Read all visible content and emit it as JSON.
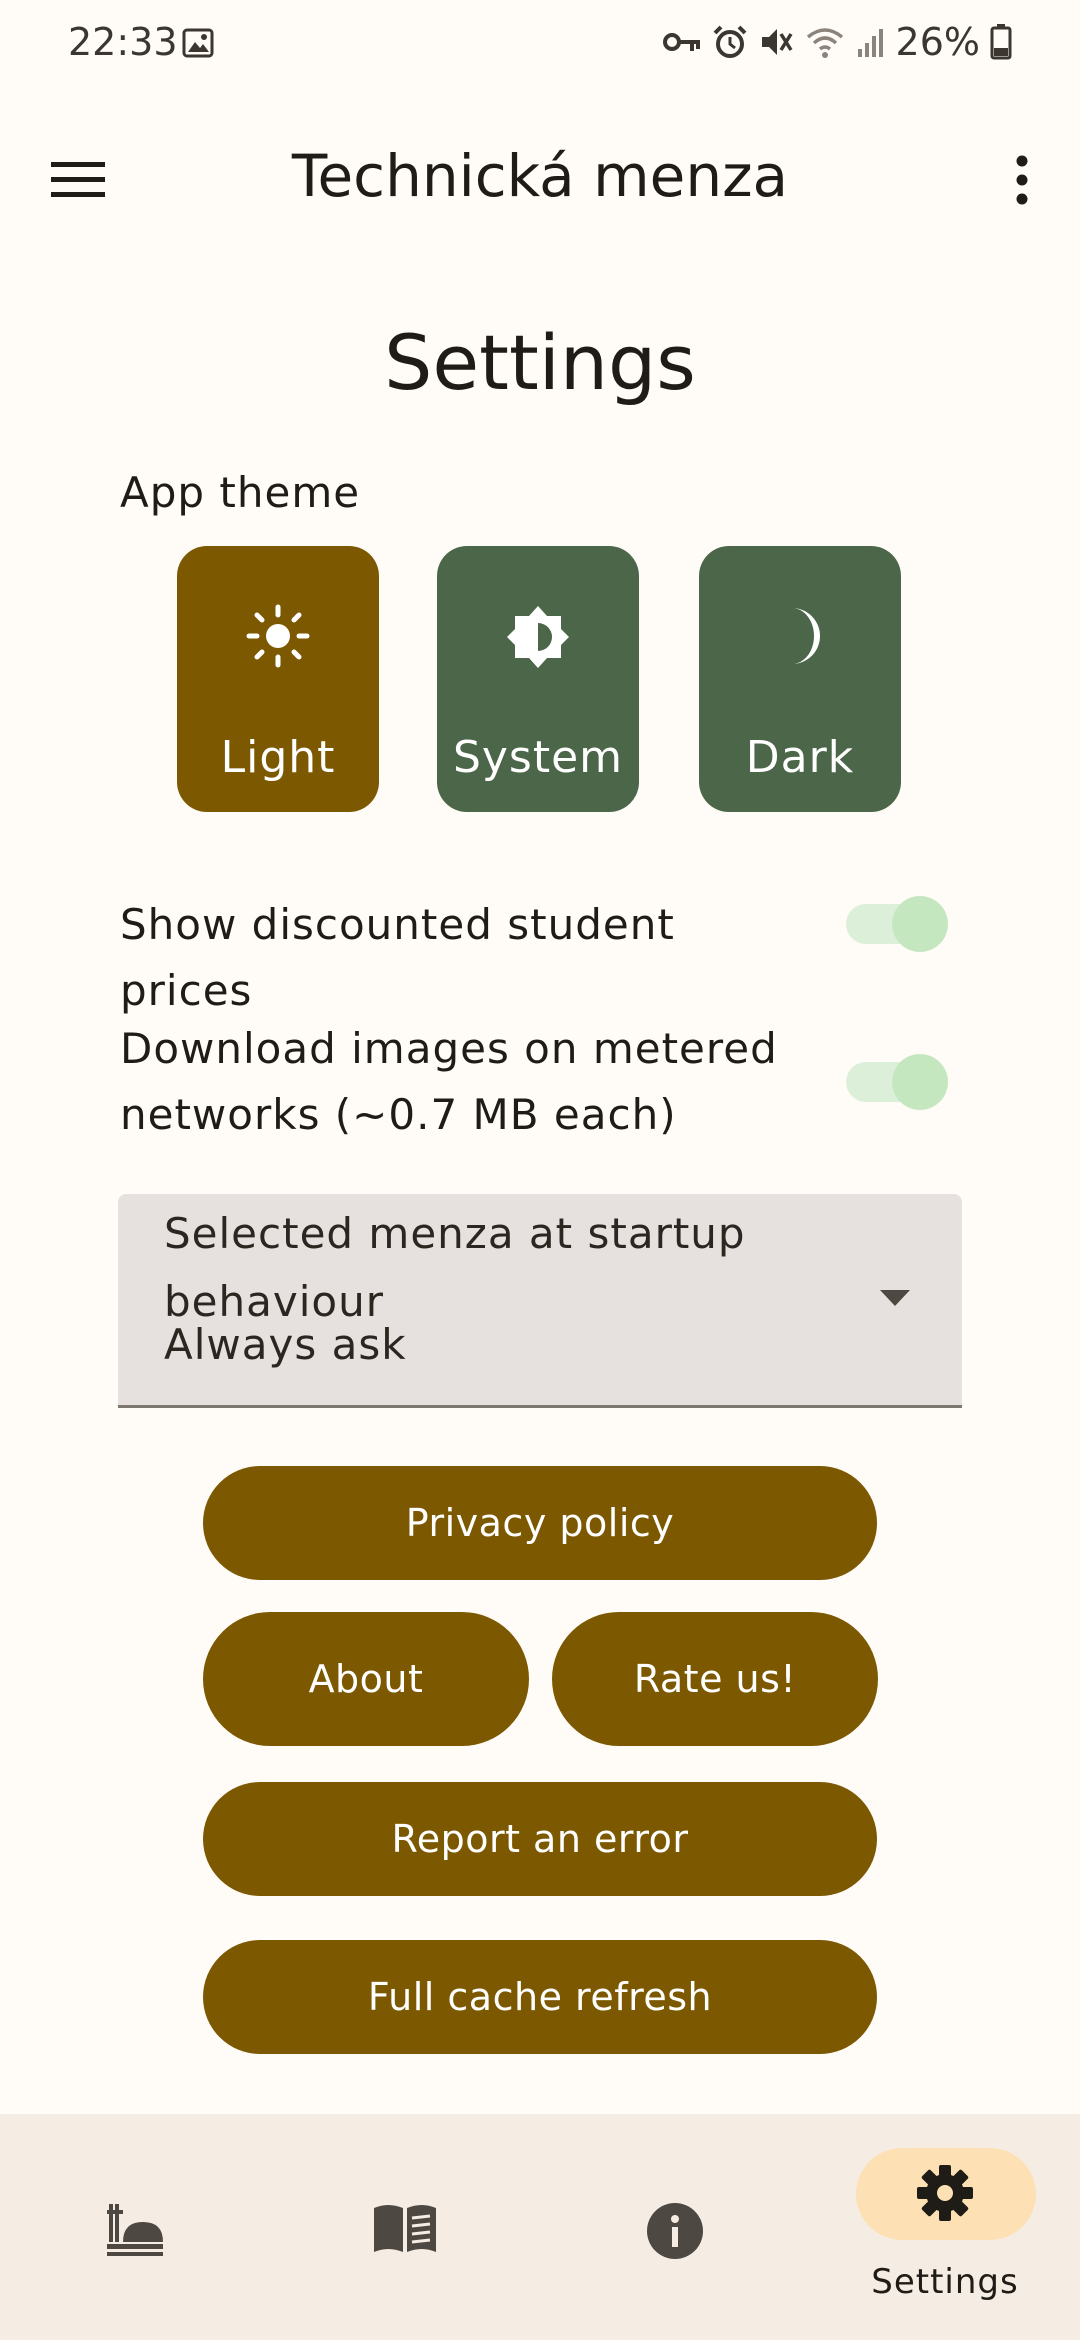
{
  "status_bar": {
    "time": "22:33",
    "battery_text": "26%"
  },
  "app_bar": {
    "title": "Technická menza"
  },
  "page": {
    "title": "Settings"
  },
  "theme": {
    "section_label": "App theme",
    "options": [
      {
        "label": "Light",
        "selected": true
      },
      {
        "label": "System",
        "selected": false
      },
      {
        "label": "Dark",
        "selected": false
      }
    ]
  },
  "toggles": [
    {
      "label": "Show discounted student prices",
      "on": true
    },
    {
      "label": "Download images on metered networks (~0.7 MB each)",
      "on": true
    }
  ],
  "startup_dropdown": {
    "label": "Selected menza at startup behaviour",
    "value": "Always ask"
  },
  "buttons": {
    "privacy": "Privacy policy",
    "about": "About",
    "rate": "Rate us!",
    "report": "Report an error",
    "cache": "Full cache refresh"
  },
  "bottom_nav": {
    "items": [
      {
        "icon": "food-tray-icon",
        "label": ""
      },
      {
        "icon": "menu-book-icon",
        "label": ""
      },
      {
        "icon": "info-icon",
        "label": ""
      },
      {
        "icon": "gear-icon",
        "label": "Settings",
        "active": true
      }
    ]
  },
  "colors": {
    "primary": "#7c5800",
    "secondary": "#4b6648",
    "background": "#fffbf7",
    "nav_background": "#f5ede4",
    "nav_active": "#fde0b4"
  }
}
